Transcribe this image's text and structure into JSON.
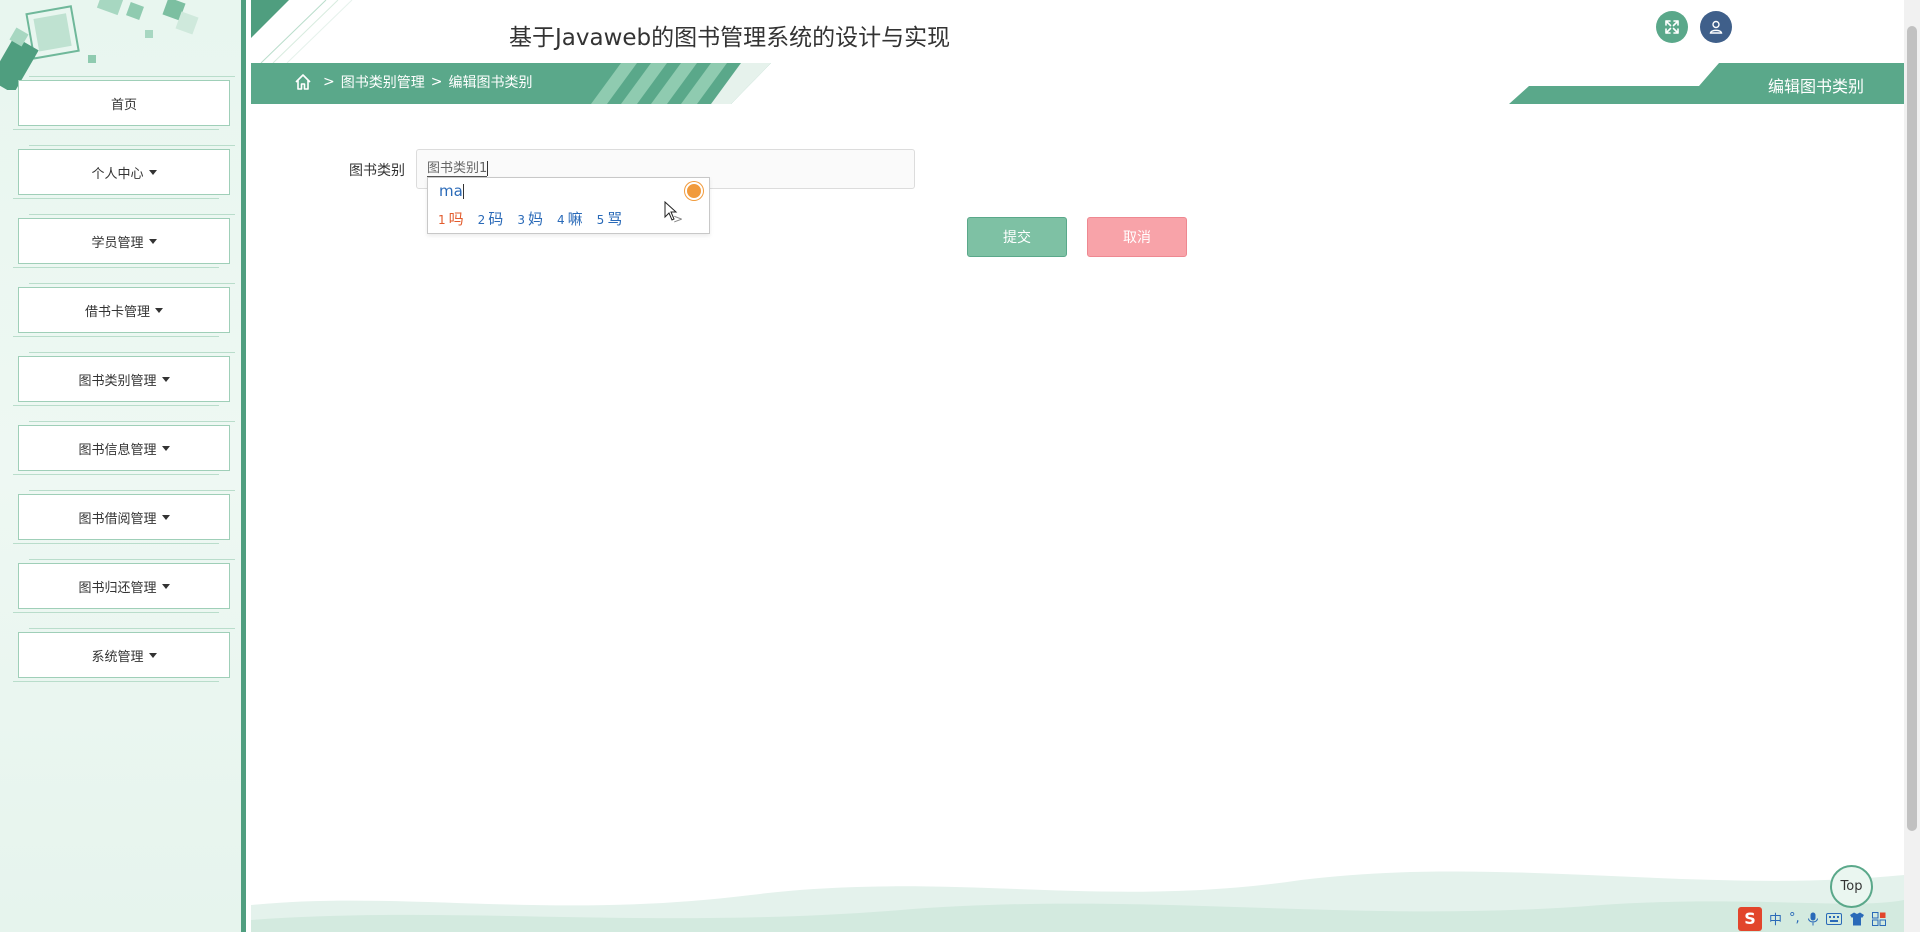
{
  "app": {
    "title": "基于Javaweb的图书管理系统的设计与实现"
  },
  "sidebar": {
    "items": [
      {
        "label": "首页",
        "dropdown": false
      },
      {
        "label": "个人中心",
        "dropdown": true
      },
      {
        "label": "学员管理",
        "dropdown": true
      },
      {
        "label": "借书卡管理",
        "dropdown": true
      },
      {
        "label": "图书类别管理",
        "dropdown": true
      },
      {
        "label": "图书信息管理",
        "dropdown": true
      },
      {
        "label": "图书借阅管理",
        "dropdown": true
      },
      {
        "label": "图书归还管理",
        "dropdown": true
      },
      {
        "label": "系统管理",
        "dropdown": true
      }
    ]
  },
  "breadcrumb": {
    "sep": ">",
    "level1": "图书类别管理",
    "level2": "编辑图书类别"
  },
  "page_title": "编辑图书类别",
  "form": {
    "label": "图书类别",
    "value": "图书类别1",
    "submit_label": "提交",
    "cancel_label": "取消"
  },
  "ime": {
    "composition": "ma",
    "candidates": [
      {
        "n": "1",
        "text": "吗"
      },
      {
        "n": "2",
        "text": "码"
      },
      {
        "n": "3",
        "text": "妈"
      },
      {
        "n": "4",
        "text": "嘛"
      },
      {
        "n": "5",
        "text": "骂"
      }
    ],
    "next": ">"
  },
  "top_button": "Top",
  "taskbar": {
    "logo": "S",
    "lang": "中"
  },
  "colors": {
    "primary": "#4f9e7f",
    "submit": "#7ec1a4",
    "cancel": "#f8a3a9",
    "user_button": "#3f5f8a"
  },
  "icons": {
    "home": "home-icon",
    "expand": "fullscreen-icon",
    "user": "user-icon"
  }
}
